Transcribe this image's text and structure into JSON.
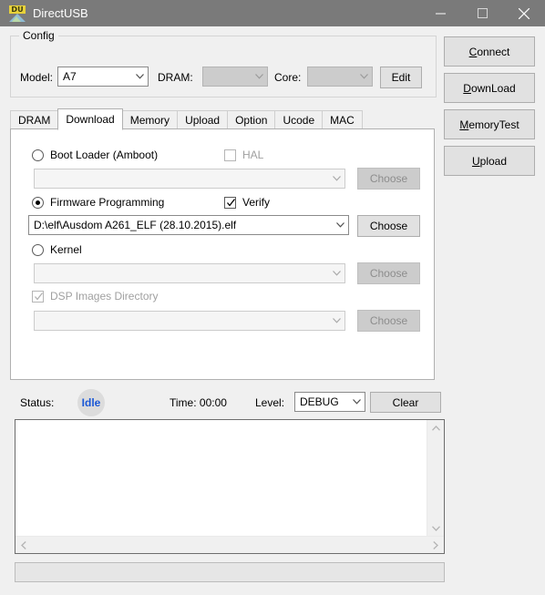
{
  "window": {
    "title": "DirectUSB",
    "icon": "directusb-app-icon",
    "controls": {
      "minimize": "minimize-icon",
      "maximize": "maximize-icon",
      "close": "close-icon"
    }
  },
  "config": {
    "group_title": "Config",
    "model_label": "Model:",
    "model_value": "A7",
    "dram_label": "DRAM:",
    "dram_value": "",
    "core_label": "Core:",
    "core_value": "",
    "edit_button": "Edit"
  },
  "side_buttons": [
    {
      "label": "Connect",
      "accel": "C",
      "rest": "onnect"
    },
    {
      "label": "DownLoad",
      "accel": "D",
      "rest": "ownLoad"
    },
    {
      "label": "MemoryTest",
      "accel": "M",
      "rest": "emoryTest"
    },
    {
      "label": "Upload",
      "accel": "U",
      "rest": "pload"
    }
  ],
  "tabs": [
    {
      "label": "DRAM",
      "active": false
    },
    {
      "label": "Download",
      "active": true
    },
    {
      "label": "Memory",
      "active": false
    },
    {
      "label": "Upload",
      "active": false
    },
    {
      "label": "Option",
      "active": false
    },
    {
      "label": "Ucode",
      "active": false
    },
    {
      "label": "MAC",
      "active": false
    }
  ],
  "download_tab": {
    "bootloader": {
      "radio_label": "Boot Loader (Amboot)",
      "selected": false,
      "hal_label": "HAL",
      "hal_checked": false,
      "path_value": "",
      "choose_label": "Choose"
    },
    "firmware": {
      "radio_label": "Firmware Programming",
      "selected": true,
      "verify_label": "Verify",
      "verify_checked": true,
      "path_value": "D:\\elf\\Ausdom A261_ELF (28.10.2015).elf",
      "choose_label": "Choose"
    },
    "kernel": {
      "radio_label": "Kernel",
      "selected": false,
      "path_value": "",
      "choose_label": "Choose"
    },
    "dsp": {
      "check_label": "DSP Images Directory",
      "checked": true,
      "path_value": "",
      "choose_label": "Choose"
    }
  },
  "status_bar": {
    "status_label": "Status:",
    "status_value": "Idle",
    "status_color": "#1a57d6",
    "time_label": "Time: 00:00",
    "level_label": "Level:",
    "level_value": "DEBUG",
    "clear_button": "Clear"
  },
  "log": {
    "content": ""
  },
  "progress": {
    "value": ""
  }
}
